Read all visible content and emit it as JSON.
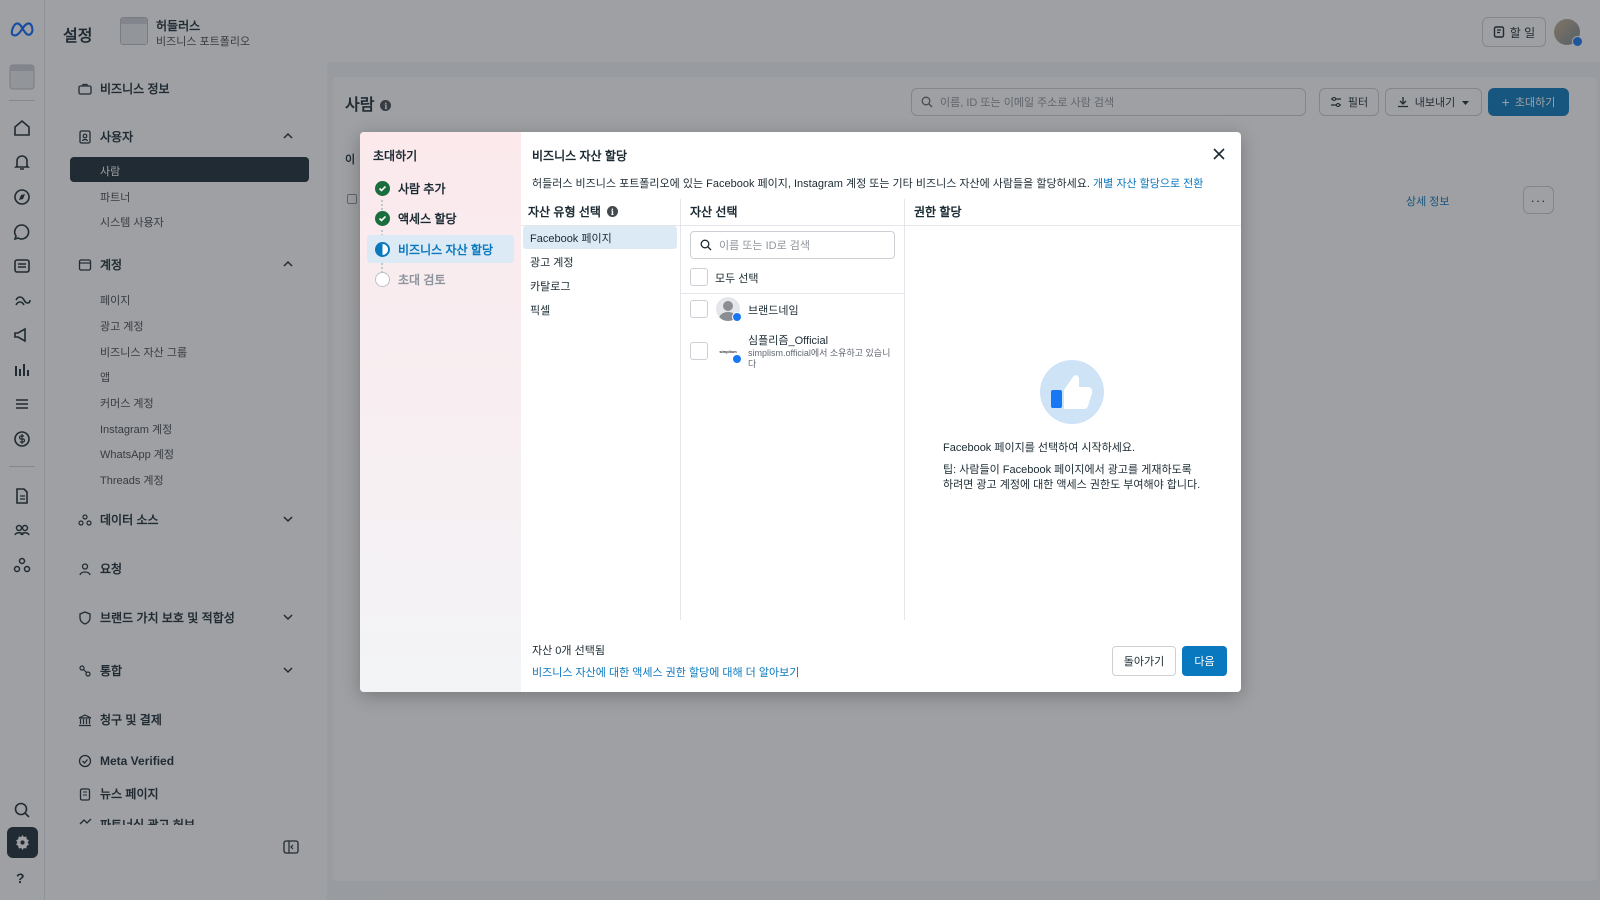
{
  "header": {
    "settings_title": "설정",
    "portfolio_name": "허들러스",
    "portfolio_sub": "비즈니스 포트폴리오",
    "todo_label": "할 일"
  },
  "sidebar": {
    "business_info": "비즈니스 정보",
    "users": "사용자",
    "users_sub": [
      "사람",
      "파트너",
      "시스템 사용자"
    ],
    "accounts": "계정",
    "accounts_sub": [
      "페이지",
      "광고 계정",
      "비즈니스 자산 그룹",
      "앱",
      "커머스 계정",
      "Instagram 계정",
      "WhatsApp 계정",
      "Threads 계정"
    ],
    "data_sources": "데이터 소스",
    "requests": "요청",
    "brand_safety": "브랜드 가치 보호 및 적합성",
    "integrations": "통합",
    "billing": "청구 및 결제",
    "meta_verified": "Meta Verified",
    "news_page": "뉴스 페이지",
    "partner_ads": "파트너십 광고 허브"
  },
  "main": {
    "title": "사람",
    "search_placeholder": "이름, ID 또는 이메일 주소로 사람 검색",
    "filter_label": "필터",
    "export_label": "내보내기",
    "invite_label": "초대하기",
    "tab_peek": "이",
    "detail_link": "상세 정보",
    "more_label": "···"
  },
  "modal": {
    "stepper_title": "초대하기",
    "steps": [
      {
        "label": "사람 추가",
        "state": "done"
      },
      {
        "label": "액세스 할당",
        "state": "done"
      },
      {
        "label": "비즈니스 자산 할당",
        "state": "current"
      },
      {
        "label": "초대 검토",
        "state": "pending"
      }
    ],
    "title": "비즈니스 자산 할당",
    "description": "허들러스 비즈니스 포트폴리오에 있는 Facebook 페이지, Instagram 계정 또는 기타 비즈니스 자산에 사람들을 할당하세요.",
    "switch_link": "개별 자산 할당으로 전환",
    "col_asset_type": "자산 유형 선택",
    "col_asset_select": "자산 선택",
    "col_permission": "권한 할당",
    "asset_types": [
      "Facebook 페이지",
      "광고 계정",
      "카탈로그",
      "픽셀"
    ],
    "asset_search_placeholder": "이름 또는 ID로 검색",
    "select_all": "모두 선택",
    "pages": [
      {
        "name": "브랜드네임",
        "owner": ""
      },
      {
        "name": "심플리즘_Official",
        "owner": "simplism.official에서 소유하고 있습니다",
        "logo_text": "simplism"
      }
    ],
    "empty_message": "Facebook 페이지를 선택하여 시작하세요.",
    "tip": "팁: 사람들이 Facebook 페이지에서 광고를 게재하도록 하려면 광고 계정에 대한 액세스 권한도 부여해야 합니다.",
    "selected_count": "자산 0개 선택됨",
    "learn_more": "비즈니스 자산에 대한 액세스 권한 할당에 대해 더 알아보기",
    "back_label": "돌아가기",
    "next_label": "다음"
  },
  "rail": {
    "help_label": "?"
  },
  "colors": {
    "accent": "#0a78be",
    "dark": "#1c2b33",
    "success": "#1a6e3d",
    "facebook": "#1877f2"
  }
}
